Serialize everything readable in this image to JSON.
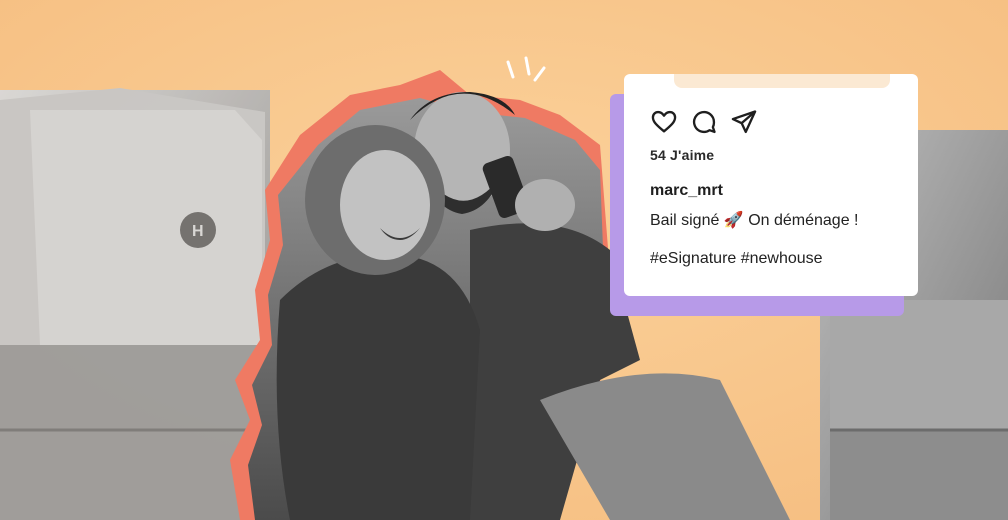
{
  "colors": {
    "background": "#f9c78a",
    "accent_coral": "#ef7a63",
    "card_shadow": "#b79ae8",
    "card_top_strip": "#fbe9d3"
  },
  "post": {
    "icons": [
      "heart-icon",
      "comment-icon",
      "send-icon"
    ],
    "likes": "54 J'aime",
    "username": "marc_mrt",
    "caption": "Bail signé 🚀 On déménage !",
    "hashtags": "#eSignature #newhouse"
  }
}
